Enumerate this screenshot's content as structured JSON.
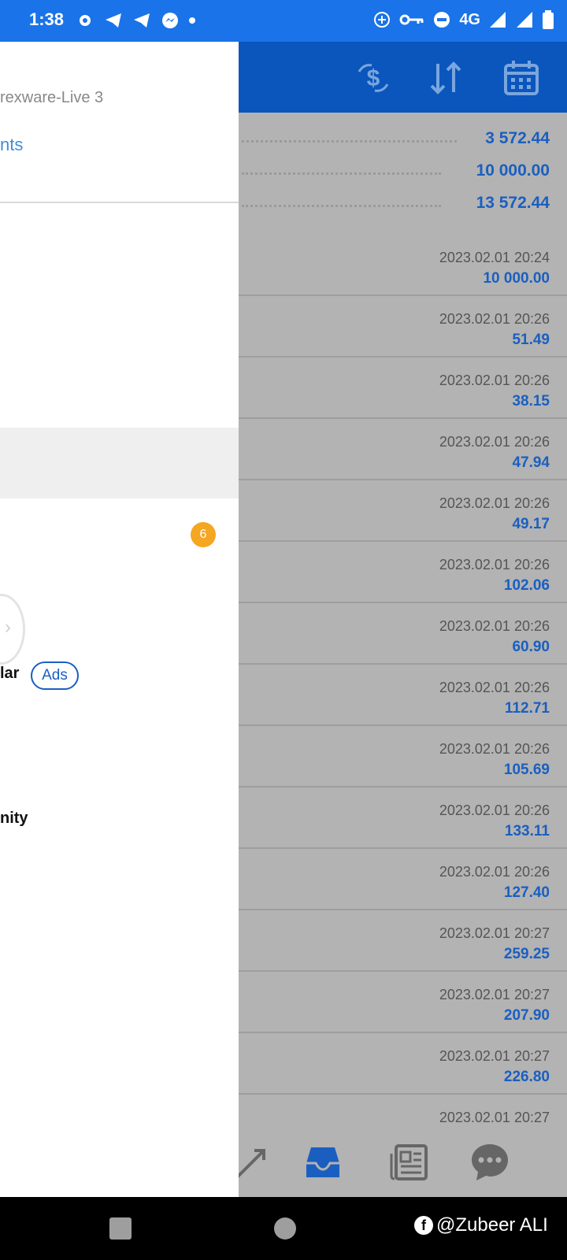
{
  "status_bar": {
    "time": "1:38",
    "network": "4G",
    "icons": [
      "gear-icon",
      "telegram-icon",
      "telegram-icon",
      "messenger-icon",
      "dot-icon",
      "data-saver-icon",
      "vpn-key-icon",
      "dnd-icon",
      "signal-icon",
      "signal-icon",
      "battery-icon"
    ]
  },
  "drawer": {
    "account_name": "rexware-Live 3",
    "accounts_link": "nts",
    "badge_count": "6",
    "regular_label": "lar",
    "ads_label": "Ads",
    "community_label": "nity"
  },
  "toolbar": {
    "icons": [
      "currency-exchange-icon",
      "sort-icon",
      "calendar-icon"
    ]
  },
  "summary": {
    "values": [
      "3 572.44",
      "10 000.00",
      "13 572.44"
    ]
  },
  "history": [
    {
      "date": "2023.02.01 20:24",
      "amount": "10 000.00"
    },
    {
      "date": "2023.02.01 20:26",
      "amount": "51.49"
    },
    {
      "date": "2023.02.01 20:26",
      "amount": "38.15"
    },
    {
      "date": "2023.02.01 20:26",
      "amount": "47.94"
    },
    {
      "date": "2023.02.01 20:26",
      "amount": "49.17"
    },
    {
      "date": "2023.02.01 20:26",
      "amount": "102.06"
    },
    {
      "date": "2023.02.01 20:26",
      "amount": "60.90"
    },
    {
      "date": "2023.02.01 20:26",
      "amount": "112.71"
    },
    {
      "date": "2023.02.01 20:26",
      "amount": "105.69"
    },
    {
      "date": "2023.02.01 20:26",
      "amount": "133.11"
    },
    {
      "date": "2023.02.01 20:26",
      "amount": "127.40"
    },
    {
      "date": "2023.02.01 20:27",
      "amount": "259.25"
    },
    {
      "date": "2023.02.01 20:27",
      "amount": "207.90"
    },
    {
      "date": "2023.02.01 20:27",
      "amount": "226.80"
    },
    {
      "date": "2023.02.01 20:27",
      "amount": ""
    }
  ],
  "bottom_nav": {
    "icons": [
      "trade-icon",
      "history-icon",
      "news-icon",
      "chat-icon"
    ],
    "active": "history-icon"
  },
  "watermark": "@Zubeer ALI",
  "colors": {
    "status_bar": "#1a73e8",
    "toolbar": "#0a56bd",
    "value_blue": "#1a5fc0",
    "link_blue": "#3f8ed8",
    "badge_orange": "#f5a623",
    "dim_gray": "#b3b3b3"
  }
}
